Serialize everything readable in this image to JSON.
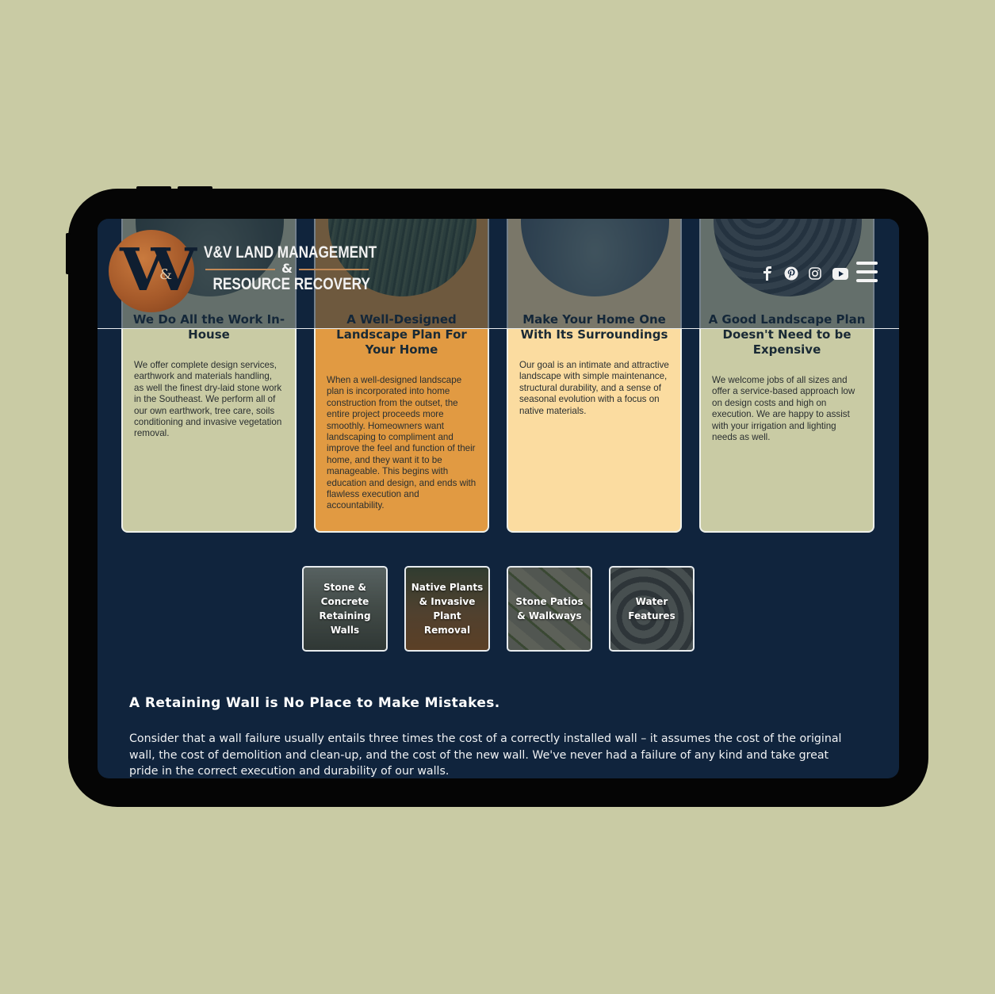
{
  "brand": {
    "logo_monogram": "V&V",
    "name_line1": "V&V LAND MANAGEMENT",
    "name_amp": "&",
    "name_line2": "RESOURCE RECOVERY"
  },
  "header": {
    "social": [
      {
        "icon": "facebook-icon"
      },
      {
        "icon": "pinterest-icon"
      },
      {
        "icon": "instagram-icon"
      },
      {
        "icon": "youtube-icon"
      }
    ],
    "menu_icon": "hamburger-menu-icon"
  },
  "cards": [
    {
      "title": "We Do All the Work In-House",
      "body": "We offer complete design services, earthwork and materials handling, as well the finest dry-laid stone work in the Southeast. We perform all of our own earthwork, tree care, soils conditioning and invasive vegetation removal.",
      "color": "#c9cba4"
    },
    {
      "title": "A Well-Designed Landscape Plan For Your Home",
      "body": "When a well-designed landscape plan is incorporated into home construction from the outset, the entire project proceeds more smoothly. Homeowners want landscaping to compliment and improve the feel and function of their home, and they want it to be manageable. This begins with education and design, and ends with flawless execution and accountability.",
      "color": "#e19a42"
    },
    {
      "title": "Make Your Home One With Its Surroundings",
      "body": "Our goal is an intimate and attractive landscape with simple maintenance, structural durability, and a sense of seasonal evolution with a focus on native materials.",
      "color": "#fbdca0"
    },
    {
      "title": "A Good Landscape Plan Doesn't Need to be Expensive",
      "body": "We welcome jobs of all sizes and offer a service-based approach low on design costs and high on execution. We are happy to assist with your irrigation and lighting needs as well.",
      "color": "#c9cba4"
    }
  ],
  "services": [
    {
      "label": "Stone & Concrete Retaining Walls"
    },
    {
      "label": "Native Plants & Invasive Plant Removal"
    },
    {
      "label": "Stone Patios & Walkways"
    },
    {
      "label": "Water Features"
    }
  ],
  "section": {
    "title": "A Retaining Wall is No Place to Make Mistakes.",
    "body": "Consider that a wall failure usually entails three times the cost of a correctly installed wall – it assumes the cost of the original wall, the cost of demolition and clean-up, and the cost of the new wall. We've never had a failure of any kind and take great pride in the correct execution and durability of our walls."
  },
  "colors": {
    "background": "#c9cba4",
    "screen": "#10243d",
    "accent_orange": "#e19a42",
    "accent_peach": "#fbdca0"
  }
}
